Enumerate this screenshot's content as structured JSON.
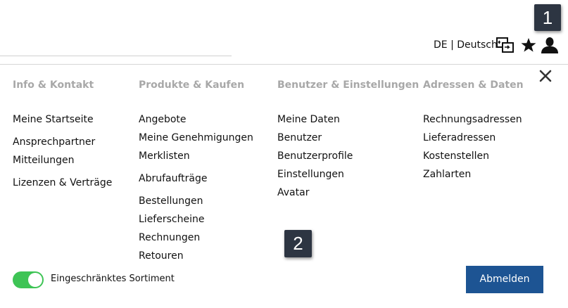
{
  "header": {
    "language_label": "DE | Deutsch",
    "icons": [
      "switch-account-icon",
      "star-icon",
      "user-icon"
    ]
  },
  "annotations": {
    "badge_1": "1",
    "badge_2": "2"
  },
  "menu": {
    "columns": [
      {
        "heading": "Info & Kontakt",
        "items": [
          "Meine Startseite",
          "Ansprechpartner",
          "Mitteilungen",
          "Lizenzen & Verträge"
        ]
      },
      {
        "heading": "Produkte & Kaufen",
        "items": [
          "Angebote",
          "Meine Genehmigungen",
          "Merklisten",
          "Abrufaufträge",
          "Bestellungen",
          "Lieferscheine",
          "Rechnungen",
          "Retouren"
        ]
      },
      {
        "heading": "Benutzer & Einstellungen",
        "items": [
          "Meine Daten",
          "Benutzer",
          "Benutzerprofile",
          "Einstellungen",
          "Avatar"
        ]
      },
      {
        "heading": "Adressen & Daten",
        "items": [
          "Rechnungsadressen",
          "Lieferadressen",
          "Kostenstellen",
          "Zahlarten"
        ]
      }
    ]
  },
  "footer": {
    "toggle_label": "Eingeschränktes Sortiment",
    "toggle_on": true,
    "logout_label": "Abmelden"
  },
  "colors": {
    "toggle_on": "#3ec455",
    "button_primary": "#1d5493",
    "badge_bg": "#2d3542",
    "heading_gray": "#a8a8a8"
  }
}
